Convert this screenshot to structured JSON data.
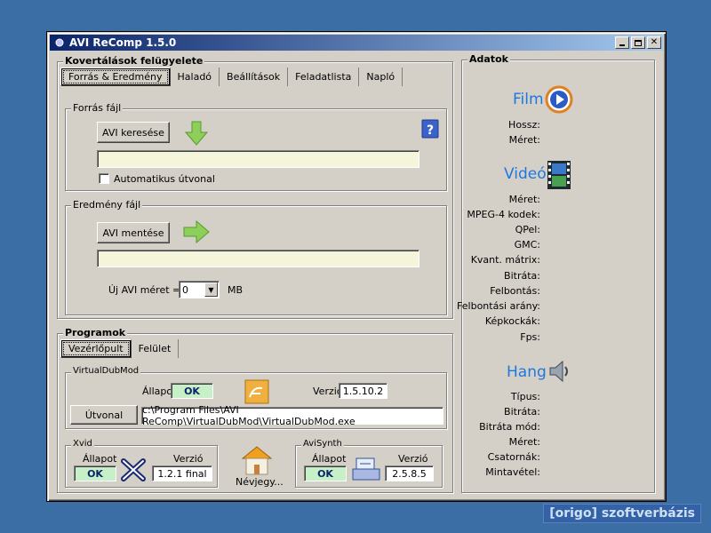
{
  "window": {
    "title": "AVI ReComp  1.5.0"
  },
  "conversion": {
    "group_title": "Kovertálások felügyelete",
    "tabs": [
      "Forrás & Eredmény",
      "Haladó",
      "Beállítások",
      "Feladatlista",
      "Napló"
    ],
    "source": {
      "group_title": "Forrás fájl",
      "browse_button": "AVI keresése",
      "path": "",
      "auto_path_label": "Automatikus útvonal"
    },
    "output": {
      "group_title": "Eredmény fájl",
      "save_button": "AVI mentése",
      "path": "",
      "size_label": "Új AVI méret =",
      "size_value": "0",
      "size_unit": "MB"
    }
  },
  "programs": {
    "group_title": "Programok",
    "tabs": [
      "Vezérlőpult",
      "Felület"
    ],
    "virtualdub": {
      "group_title": "VirtualDubMod",
      "status_label": "Állapot",
      "status_value": "OK",
      "version_label": "Verzió",
      "version_value": "1.5.10.2",
      "path_button": "Útvonal",
      "path": "c:\\Program Files\\AVI ReComp\\VirtualDubMod\\VirtualDubMod.exe"
    },
    "xvid": {
      "group_title": "Xvid",
      "status_label": "Állapot",
      "status_value": "OK",
      "version_label": "Verzió",
      "version_value": "1.2.1 final"
    },
    "about_label": "Névjegy...",
    "avisynth": {
      "group_title": "AviSynth",
      "status_label": "Állapot",
      "status_value": "OK",
      "version_label": "Verzió",
      "version_value": "2.5.8.5"
    }
  },
  "data_panel": {
    "group_title": "Adatok",
    "film": {
      "title": "Film",
      "labels": [
        "Hossz:",
        "Méret:"
      ]
    },
    "video": {
      "title": "Videó",
      "labels": [
        "Méret:",
        "MPEG-4 kodek:",
        "QPel:",
        "GMC:",
        "Kvant. mátrix:",
        "Bitráta:",
        "Felbontás:",
        "Felbontási arány:",
        "Képkockák:",
        "Fps:"
      ]
    },
    "audio": {
      "title": "Hang",
      "labels": [
        "Típus:",
        "Bitráta:",
        "Bitráta mód:",
        "Méret:",
        "Csatornák:",
        "Mintavétel:"
      ]
    }
  },
  "watermark": "[origo] szoftverbázis",
  "colors": {
    "titlebar_start": "#0a246a",
    "titlebar_end": "#a6caf0",
    "window_bg": "#d4d0c8",
    "desktop": "#3a6ea5",
    "section_title": "#1e78e0",
    "ok_bg": "#c8f0c8",
    "input_bg": "#f5f5dc"
  }
}
